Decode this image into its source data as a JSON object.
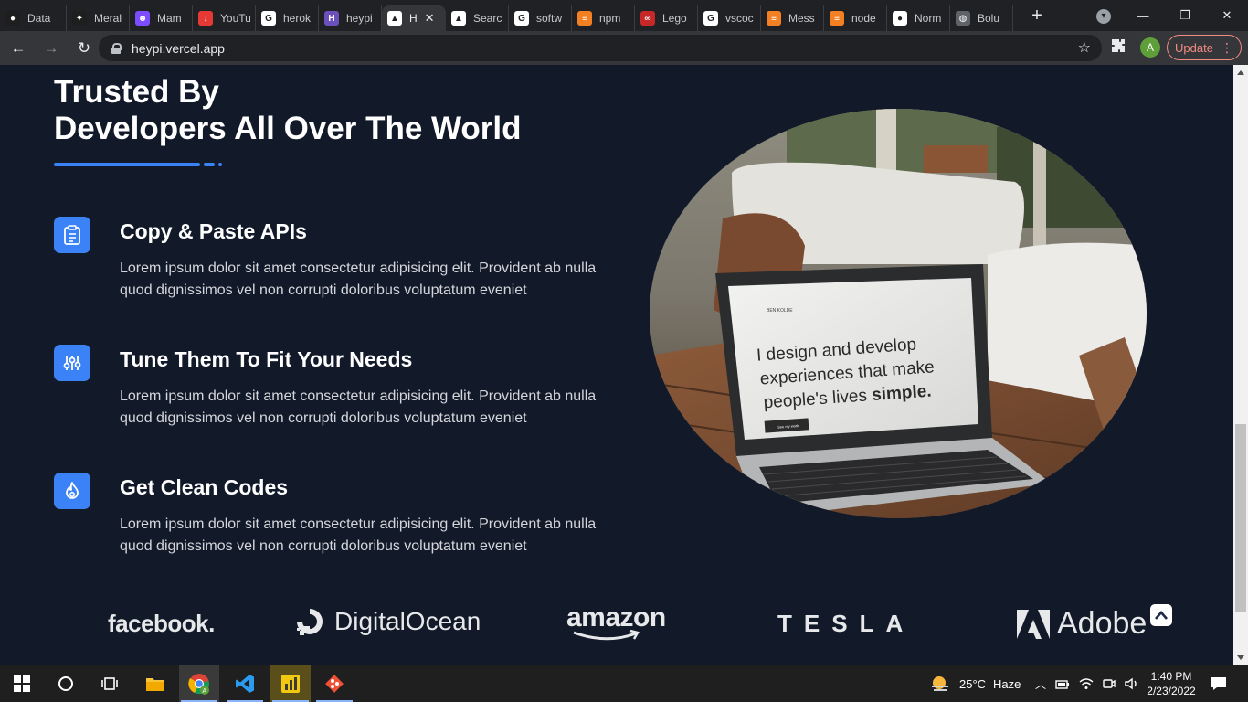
{
  "browser": {
    "tabs": [
      {
        "label": "Data",
        "fav_color": "#1e1e1e",
        "fav_icon": "leaf-icon",
        "glyph": "●"
      },
      {
        "label": "Meral",
        "fav_color": "#1e1e1e",
        "fav_icon": "bird-icon",
        "glyph": "✦"
      },
      {
        "label": "Mam",
        "fav_color": "#7c4dff",
        "fav_icon": "bot-icon",
        "glyph": "☻"
      },
      {
        "label": "YouTu",
        "fav_color": "#e53935",
        "fav_icon": "download-icon",
        "glyph": "↓"
      },
      {
        "label": "herok",
        "fav_color": "#ffffff",
        "fav_icon": "google-icon",
        "glyph": "G"
      },
      {
        "label": "heypi",
        "fav_color": "#6b4fbb",
        "fav_icon": "heroku-icon",
        "glyph": "H"
      },
      {
        "label": "H",
        "fav_color": "#ffffff",
        "fav_icon": "vercel-icon",
        "glyph": "▲",
        "active": true
      },
      {
        "label": "Searc",
        "fav_color": "#ffffff",
        "fav_icon": "vercel-icon",
        "glyph": "▲"
      },
      {
        "label": "softw",
        "fav_color": "#ffffff",
        "fav_icon": "google-icon",
        "glyph": "G"
      },
      {
        "label": "npm",
        "fav_color": "#f48024",
        "fav_icon": "stackoverflow-icon",
        "glyph": "≡"
      },
      {
        "label": "Lego",
        "fav_color": "#c62828",
        "fav_icon": "lego-icon",
        "glyph": "∞"
      },
      {
        "label": "vscoc",
        "fav_color": "#ffffff",
        "fav_icon": "google-icon",
        "glyph": "G"
      },
      {
        "label": "Mess",
        "fav_color": "#f48024",
        "fav_icon": "stackoverflow-icon",
        "glyph": "≡"
      },
      {
        "label": "node",
        "fav_color": "#f48024",
        "fav_icon": "stackoverflow-icon",
        "glyph": "≡"
      },
      {
        "label": "Norm",
        "fav_color": "#ffffff",
        "fav_icon": "github-icon",
        "glyph": "●"
      },
      {
        "label": "Bolu",
        "fav_color": "#5f6368",
        "fav_icon": "globe-icon",
        "glyph": "◍"
      }
    ],
    "url": "heypi.vercel.app",
    "profile_initial": "A",
    "update_label": "Update"
  },
  "section": {
    "title_line1": "Trusted By",
    "title_line2": "Developers All Over The World"
  },
  "features": [
    {
      "title": "Copy & Paste APIs",
      "body": "Lorem ipsum dolor sit amet consectetur adipisicing elit. Provident ab nulla quod dignissimos vel non corrupti doloribus voluptatum eveniet",
      "icon": "clipboard-icon"
    },
    {
      "title": "Tune Them To Fit Your Needs",
      "body": "Lorem ipsum dolor sit amet consectetur adipisicing elit. Provident ab nulla quod dignissimos vel non corrupti doloribus voluptatum eveniet",
      "icon": "sliders-icon"
    },
    {
      "title": "Get Clean Codes",
      "body": "Lorem ipsum dolor sit amet consectetur adipisicing elit. Provident ab nulla quod dignissimos vel non corrupti doloribus voluptatum eveniet",
      "icon": "fire-icon"
    }
  ],
  "photo": {
    "brand": "BEN KOLDE",
    "screen_line1": "I design and develop",
    "screen_line2": "experiences that make",
    "screen_line3_prefix": "people's lives ",
    "screen_line3_bold": "simple.",
    "screen_button": "See my work"
  },
  "logos": [
    "facebook.",
    "DigitalOcean",
    "amazon",
    "TESLA",
    "Adobe"
  ],
  "taskbar": {
    "weather_temp": "25°C",
    "weather_desc": "Haze",
    "time": "1:40 PM",
    "date": "2/23/2022"
  },
  "colors": {
    "page_bg": "#121a2a",
    "accent": "#3b82f6"
  }
}
